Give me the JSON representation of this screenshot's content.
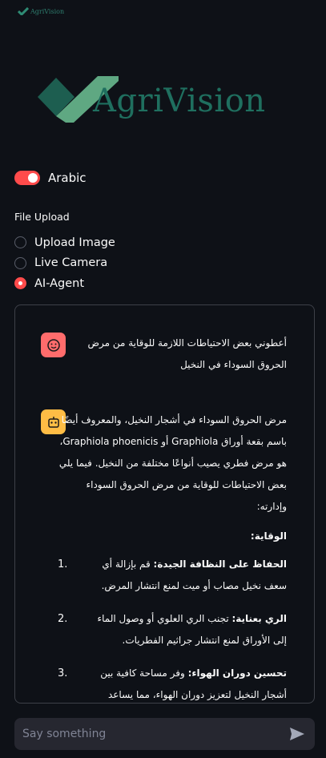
{
  "app": {
    "small_logo_text": "AgriVision",
    "logo_text": "AgriVision"
  },
  "toggle": {
    "label": "Arabic",
    "on": true
  },
  "file_upload": {
    "label": "File Upload",
    "options": [
      "Upload Image",
      "Live Camera",
      "AI-Agent"
    ],
    "selected": "AI-Agent"
  },
  "chat": {
    "user_message": "أعطوني بعض الاحتياطات اللازمة للوقاية من مرض الحروق السوداء في النخيل",
    "bot_intro": "مرض الحروق السوداء في أشجار النخيل، والمعروف أيضًا باسم بقعة أوراق Graphiola أو Graphiola phoenicis، هو مرض فطري يصيب أنواعًا مختلفة من النخيل. فيما يلي بعض الاحتياطات للوقاية من مرض الحروق السوداء وإدارته:",
    "prevention_heading": "الوقاية:",
    "items": [
      {
        "num": "1.",
        "title": "الحفاظ على النظافة الجيدة:",
        "text": " قم بإزالة أي سعف نخيل مصاب أو ميت لمنع انتشار المرض."
      },
      {
        "num": "2.",
        "title": "الري بعناية:",
        "text": " تجنب الري العلوي أو وصول الماء إلى الأوراق لمنع انتشار جراثيم الفطريات."
      },
      {
        "num": "3.",
        "title": "تحسين دوران الهواء:",
        "text": " وفر مساحة كافية بين أشجار النخيل لتعزيز دوران الهواء، مما يساعد على منع"
      }
    ]
  },
  "input": {
    "placeholder": "Say something"
  },
  "colors": {
    "accent": "#ff4b4b",
    "background": "#0e1117",
    "brand": "#1f6f5f",
    "user_avatar": "#ff6c6c",
    "bot_avatar": "#ffbd45"
  }
}
